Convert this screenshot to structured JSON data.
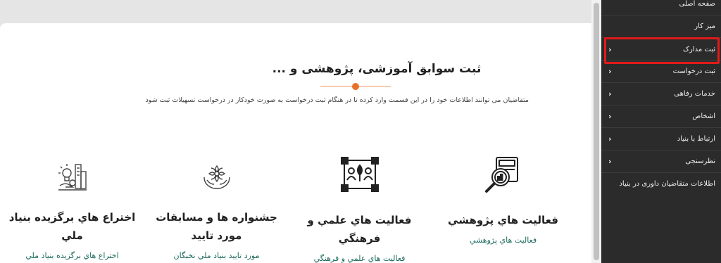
{
  "main": {
    "title": "ثبت سوابق آموزشی، پژوهشی و ...",
    "subtitle": "متقاضیان می توانند اطلاعات خود را در این قسمت وارد کرده تا در هنگام ثبت درخواست به صورت خودکار در درخواست تسهیلات ثبت شود",
    "accent_color": "#e8702a",
    "cards": [
      {
        "icon": "research-report-magnifier-icon",
        "title": "فعاليت هاي پژوهشي",
        "link": "فعاليت هاي پژوهشي"
      },
      {
        "icon": "cultural-activity-presentation-icon",
        "title": "فعاليت هاي علمي و فرهنگي",
        "link": "فعاليت هاي علمي و فرهنگي"
      },
      {
        "icon": "award-lotus-hands-icon",
        "title": "جشنواره ها و مسابقات مورد تاييد",
        "link": "مورد تاييد بنياد ملي نخبگان"
      },
      {
        "icon": "invention-lightbulb-gear-icon",
        "title": "اختراع هاي برگزيده بنياد ملي",
        "link": "اختراع هاي برگزيده بنياد ملي"
      }
    ]
  },
  "sidebar": {
    "background": "#2b2b2b",
    "highlight_color": "#e21a1a",
    "items": [
      {
        "label": "صفحه اصلی",
        "has_arrow": false
      },
      {
        "label": "میز کار",
        "has_arrow": false
      },
      {
        "label": "ثبت مدارک",
        "has_arrow": true
      },
      {
        "label": "ثبت درخواست",
        "has_arrow": true
      },
      {
        "label": "خدمات رفاهی",
        "has_arrow": true
      },
      {
        "label": "اشخاص",
        "has_arrow": true
      },
      {
        "label": "ارتباط با بنیاد",
        "has_arrow": true
      },
      {
        "label": "نظرسنجی",
        "has_arrow": true
      },
      {
        "label": "اطلاعات متقاضیان داوری در بنیاد",
        "has_arrow": false
      }
    ]
  }
}
